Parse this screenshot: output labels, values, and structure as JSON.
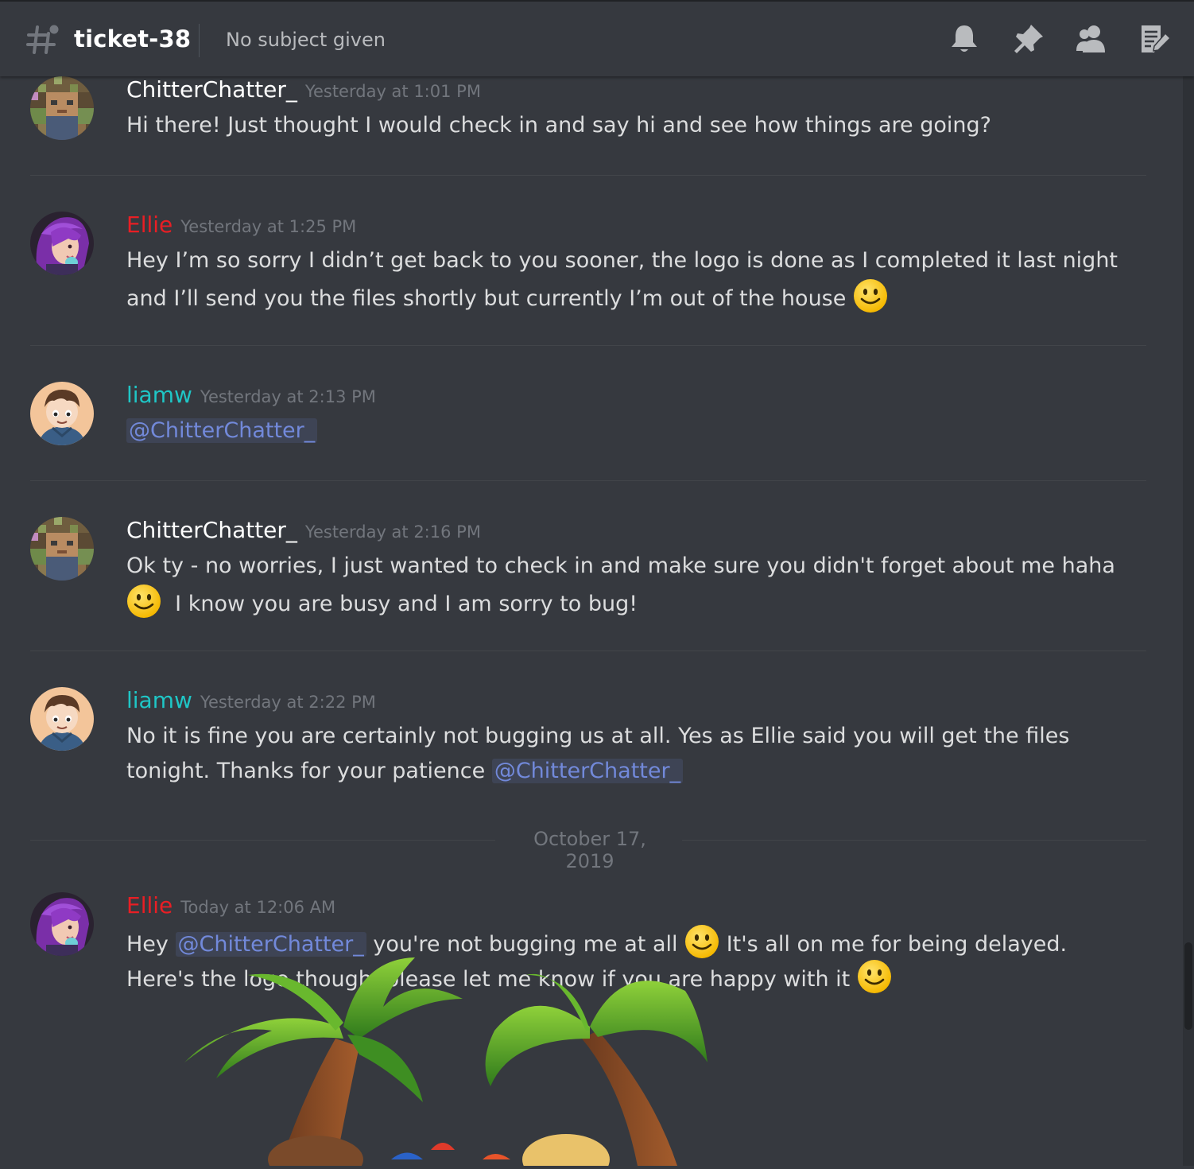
{
  "header": {
    "channel_name": "ticket-38",
    "topic": "No subject given",
    "icons": [
      "channel-hash-icon",
      "notification-bell-icon",
      "pin-icon",
      "members-icon",
      "edit-notes-icon"
    ]
  },
  "messages": [
    {
      "author": "ChitterChatter_",
      "author_color": "#ffffff",
      "timestamp": "Yesterday at 1:01 PM",
      "lines": [
        "Hi there! Just thought I would check in and say hi and see how things are going?"
      ]
    },
    {
      "author": "Ellie",
      "author_color": "#e91e24",
      "timestamp": "Yesterday at 1:25 PM",
      "lines": [
        "Hey I’m so sorry I didn’t get back to you sooner, the logo is done as I completed it last night",
        "and I’ll send you the files shortly but currently I’m out of the house"
      ],
      "emoji": "slightly-smiling-face"
    },
    {
      "author": "liamw",
      "author_color": "#1fc6c6",
      "timestamp": "Yesterday at 2:13 PM",
      "mention": "@ChitterChatter_"
    },
    {
      "author": "ChitterChatter_",
      "author_color": "#ffffff",
      "timestamp": "Yesterday at 2:16 PM",
      "lines": [
        "Ok ty - no worries, I just wanted to check in and make sure you didn't forget about me haha",
        "I know you are busy and I am sorry to bug!"
      ],
      "emoji": "slightly-smiling-face"
    },
    {
      "author": "liamw",
      "author_color": "#1fc6c6",
      "timestamp": "Yesterday at 2:22 PM",
      "lines": [
        "No it is fine you are certainly not bugging us at all. Yes as Ellie said you will get the files",
        "tonight. Thanks for your patience"
      ],
      "mention": "@ChitterChatter_"
    },
    {
      "author": "Ellie",
      "author_color": "#e91e24",
      "timestamp": "Today at 12:06 AM",
      "line1_a": "Hey",
      "mention": "@ChitterChatter_",
      "line1_b": "you're not bugging me at all",
      "line1_c": "It's all on me for being delayed.",
      "line2": "Here's the logo though, please let me know if you are happy with it",
      "emoji": "slightly-smiling-face",
      "attachment": "palm-trees-logo-image"
    }
  ],
  "date_divider": "October 17, 2019",
  "colors": {
    "background": "#36393f",
    "mention": "#7289da",
    "timestamp": "#72767d",
    "text": "#dcddde"
  }
}
